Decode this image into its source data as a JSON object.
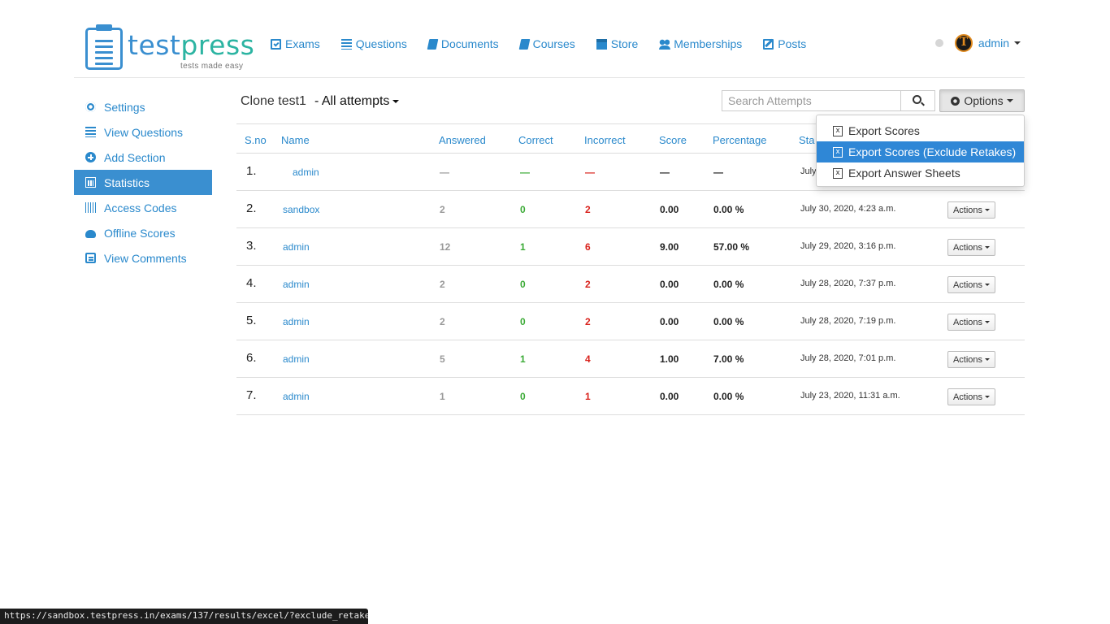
{
  "brand": {
    "name_part1": "test",
    "name_part2": "press",
    "tagline": "tests made easy"
  },
  "nav": [
    {
      "label": "Exams",
      "icon": "exams-icon"
    },
    {
      "label": "Questions",
      "icon": "list-icon"
    },
    {
      "label": "Documents",
      "icon": "book-icon"
    },
    {
      "label": "Courses",
      "icon": "book-icon"
    },
    {
      "label": "Store",
      "icon": "store-icon"
    },
    {
      "label": "Memberships",
      "icon": "users-icon"
    },
    {
      "label": "Posts",
      "icon": "edit-icon"
    }
  ],
  "user": {
    "name": "admin"
  },
  "sidebar": {
    "items": [
      {
        "label": "Settings",
        "icon": "gear-icon",
        "active": false
      },
      {
        "label": "View Questions",
        "icon": "list-icon",
        "active": false
      },
      {
        "label": "Add Section",
        "icon": "plus-circle-icon",
        "active": false
      },
      {
        "label": "Statistics",
        "icon": "bar-chart-icon",
        "active": true
      },
      {
        "label": "Access Codes",
        "icon": "barcode-icon",
        "active": false
      },
      {
        "label": "Offline Scores",
        "icon": "cloud-upload-icon",
        "active": false
      },
      {
        "label": "View Comments",
        "icon": "comment-icon",
        "active": false
      }
    ]
  },
  "page": {
    "title": "Clone test1",
    "filter": "- All attempts"
  },
  "search": {
    "placeholder": "Search Attempts"
  },
  "options": {
    "label": "Options",
    "menu": [
      {
        "label": "Export Scores",
        "active": false
      },
      {
        "label": "Export Scores (Exclude Retakes)",
        "active": true
      },
      {
        "label": "Export Answer Sheets",
        "active": false
      }
    ]
  },
  "table": {
    "headers": {
      "sno": "S.no",
      "name": "Name",
      "answered": "Answered",
      "correct": "Correct",
      "incorrect": "Incorrect",
      "score": "Score",
      "percentage": "Percentage",
      "started": "Sta"
    },
    "rows": [
      {
        "sno": "1.",
        "name": "admin",
        "answered": "—",
        "correct": "—",
        "incorrect": "—",
        "score": "—",
        "percentage": "—",
        "started": "July",
        "actions": ""
      },
      {
        "sno": "2.",
        "name": "sandbox",
        "answered": "2",
        "correct": "0",
        "incorrect": "2",
        "score": "0.00",
        "percentage": "0.00 %",
        "started": "July 30, 2020, 4:23 a.m.",
        "actions": "Actions"
      },
      {
        "sno": "3.",
        "name": "admin",
        "answered": "12",
        "correct": "1",
        "incorrect": "6",
        "score": "9.00",
        "percentage": "57.00 %",
        "started": "July 29, 2020, 3:16 p.m.",
        "actions": "Actions"
      },
      {
        "sno": "4.",
        "name": "admin",
        "answered": "2",
        "correct": "0",
        "incorrect": "2",
        "score": "0.00",
        "percentage": "0.00 %",
        "started": "July 28, 2020, 7:37 p.m.",
        "actions": "Actions"
      },
      {
        "sno": "5.",
        "name": "admin",
        "answered": "2",
        "correct": "0",
        "incorrect": "2",
        "score": "0.00",
        "percentage": "0.00 %",
        "started": "July 28, 2020, 7:19 p.m.",
        "actions": "Actions"
      },
      {
        "sno": "6.",
        "name": "admin",
        "answered": "5",
        "correct": "1",
        "incorrect": "4",
        "score": "1.00",
        "percentage": "7.00 %",
        "started": "July 28, 2020, 7:01 p.m.",
        "actions": "Actions"
      },
      {
        "sno": "7.",
        "name": "admin",
        "answered": "1",
        "correct": "0",
        "incorrect": "1",
        "score": "0.00",
        "percentage": "0.00 %",
        "started": "July 23, 2020, 11:31 a.m.",
        "actions": "Actions"
      }
    ]
  },
  "statusbar": {
    "url": "https://sandbox.testpress.in/exams/137/results/excel/?exclude_retakes=..."
  },
  "colors": {
    "brand_blue": "#3a8fd0",
    "brand_green": "#2cb4a2",
    "correct": "#3aaa35",
    "incorrect": "#d9231d",
    "menu_highlight": "#2f87d6"
  }
}
